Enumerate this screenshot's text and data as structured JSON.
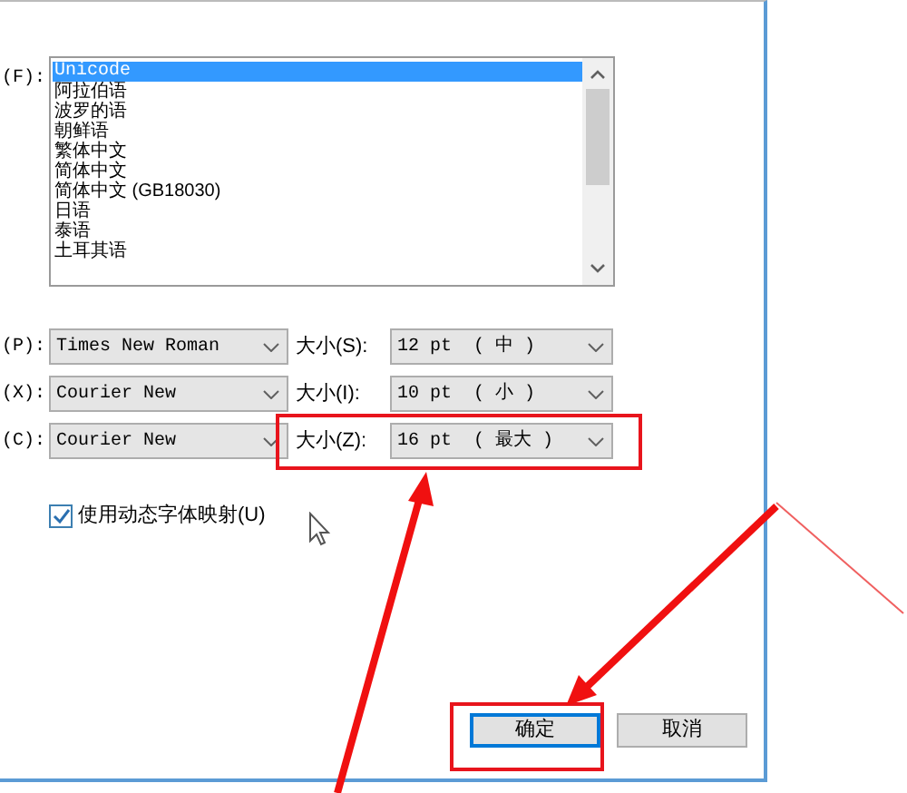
{
  "encoding_list": {
    "label": "(F):",
    "items": [
      {
        "text": "Unicode",
        "selected": true
      },
      {
        "text": "阿拉伯语",
        "selected": false
      },
      {
        "text": "波罗的语",
        "selected": false
      },
      {
        "text": "朝鲜语",
        "selected": false
      },
      {
        "text": "繁体中文",
        "selected": false
      },
      {
        "text": "简体中文",
        "selected": false
      },
      {
        "text": "简体中文 (GB18030)",
        "selected": false
      },
      {
        "text": "日语",
        "selected": false
      },
      {
        "text": "泰语",
        "selected": false
      },
      {
        "text": "土耳其语",
        "selected": false
      }
    ]
  },
  "font_rows": [
    {
      "label": "(P):",
      "font": "Times New Roman",
      "size_label": "大小(S):",
      "size": "12 pt  ( 中 )"
    },
    {
      "label": "(X):",
      "font": "Courier New",
      "size_label": "大小(I):",
      "size": "10 pt  ( 小 )"
    },
    {
      "label": "(C):",
      "font": "Courier New",
      "size_label": "大小(Z):",
      "size": "16 pt  ( 最大 )"
    }
  ],
  "dynamic_font_mapping": {
    "label": "使用动态字体映射(U)",
    "checked": true
  },
  "buttons": [
    {
      "label": "确定",
      "kind": "default"
    },
    {
      "label": "取消",
      "kind": "normal"
    }
  ]
}
